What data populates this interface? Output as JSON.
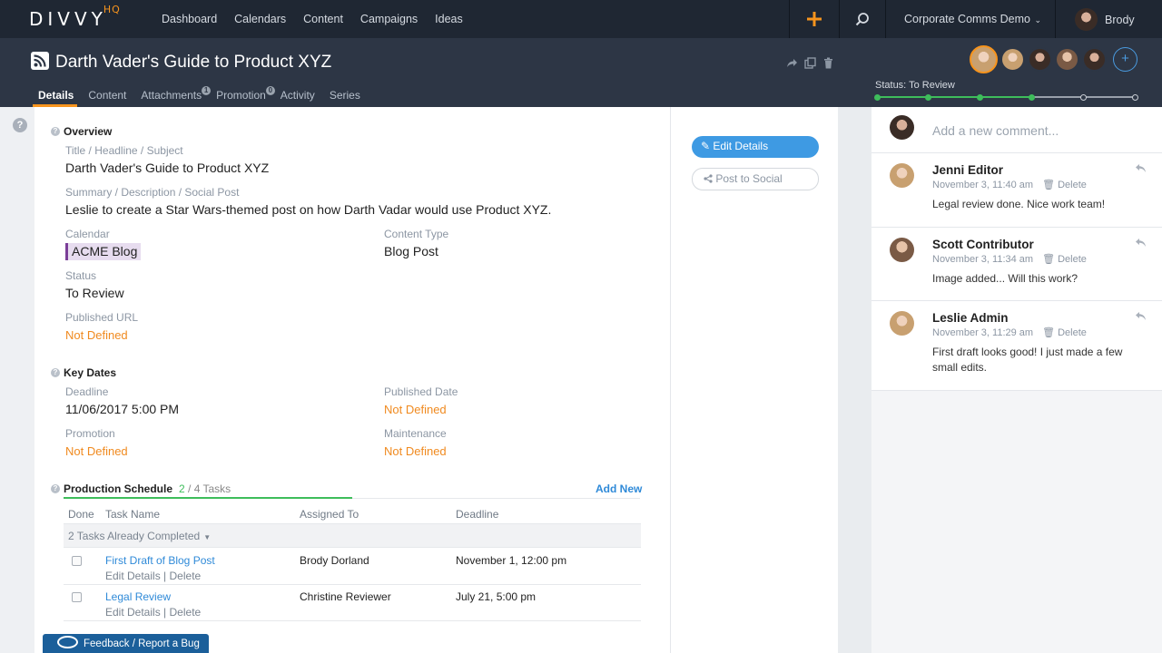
{
  "app": {
    "logo": "DIVVY",
    "logo_suffix": "HQ",
    "nav": [
      "Dashboard",
      "Calendars",
      "Content",
      "Campaigns",
      "Ideas"
    ],
    "account_name": "Corporate Comms Demo",
    "user_name": "Brody",
    "accent_color": "#f7941d"
  },
  "header": {
    "title": "Darth Vader's Guide to Product XYZ",
    "tabs": [
      {
        "label": "Details",
        "badge": ""
      },
      {
        "label": "Content",
        "badge": ""
      },
      {
        "label": "Attachments",
        "badge": "1"
      },
      {
        "label": "Promotion",
        "badge": "0"
      },
      {
        "label": "Activity",
        "badge": ""
      },
      {
        "label": "Series",
        "badge": ""
      }
    ],
    "status_label": "Status: To Review",
    "status_progress": 0.6,
    "status_steps_total": 6,
    "status_steps_done": 4,
    "add_collaborator": "+"
  },
  "details": {
    "overview": {
      "title": "Overview",
      "headline_label": "Title / Headline / Subject",
      "headline_value": "Darth Vader's Guide to Product XYZ",
      "summary_label": "Summary / Description / Social Post",
      "summary_value": "Leslie to create a Star Wars-themed post on how Darth Vadar would use Product XYZ.",
      "calendar_label": "Calendar",
      "calendar_value": "ACME Blog",
      "calendar_color": "#7b3f98",
      "content_type_label": "Content Type",
      "content_type_value": "Blog Post",
      "status_label": "Status",
      "status_value": "To Review",
      "url_label": "Published URL",
      "url_value": "Not Defined"
    },
    "key_dates": {
      "title": "Key Dates",
      "deadline_label": "Deadline",
      "deadline_value": "11/06/2017 5:00 PM",
      "published_label": "Published Date",
      "published_value": "Not Defined",
      "promotion_label": "Promotion",
      "promotion_value": "Not Defined",
      "maintenance_label": "Maintenance",
      "maintenance_value": "Not Defined"
    },
    "schedule": {
      "title": "Production Schedule",
      "done_count": "2",
      "total_label": "/ 4 Tasks",
      "add_new": "Add New",
      "columns": [
        "Done",
        "Task Name",
        "Assigned To",
        "Deadline"
      ],
      "completed_label": "2 Tasks Already Completed",
      "tasks": [
        {
          "name": "First Draft of Blog Post",
          "edit": "Edit Details",
          "sep": "|",
          "delete": "Delete",
          "assigned": "Brody Dorland",
          "deadline": "November 1, 12:00 pm"
        },
        {
          "name": "Legal Review",
          "edit": "Edit Details",
          "sep": "|",
          "delete": "Delete",
          "assigned": "Christine Reviewer",
          "deadline": "July 21, 5:00 pm"
        }
      ]
    },
    "feedback": "Feedback / Report a Bug"
  },
  "actions": {
    "edit_details": "Edit Details",
    "post_to_social": "Post to Social"
  },
  "comments": {
    "placeholder": "Add a new comment...",
    "items": [
      {
        "author": "Jenni Editor",
        "time": "November 3, 11:40 am",
        "delete": "Delete",
        "text": "Legal review done. Nice work team!"
      },
      {
        "author": "Scott Contributor",
        "time": "November 3, 11:34 am",
        "delete": "Delete",
        "text": "Image added... Will this work?"
      },
      {
        "author": "Leslie Admin",
        "time": "November 3, 11:29 am",
        "delete": "Delete",
        "text": "First draft looks good! I just made a few small edits."
      }
    ]
  }
}
